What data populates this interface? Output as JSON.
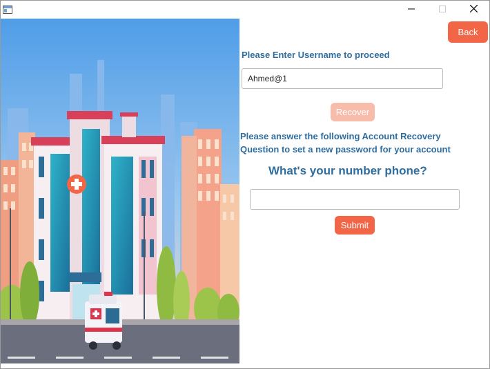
{
  "colors": {
    "accent": "#f26546",
    "accent_disabled": "#f8bcab",
    "label": "#2e6d9e"
  },
  "window": {
    "icons": [
      "app-icon",
      "minimize-icon",
      "maximize-icon",
      "close-icon"
    ]
  },
  "header": {
    "back_label": "Back"
  },
  "username": {
    "prompt": "Please Enter Username to proceed",
    "value": "Ahmed@1",
    "recover_label": "Recover"
  },
  "recovery": {
    "instruction_line1": "Please answer the following Account Recovery",
    "instruction_line2": "Question to set a new password for your account",
    "question": "What's your number phone?",
    "answer_value": "",
    "submit_label": "Submit"
  }
}
